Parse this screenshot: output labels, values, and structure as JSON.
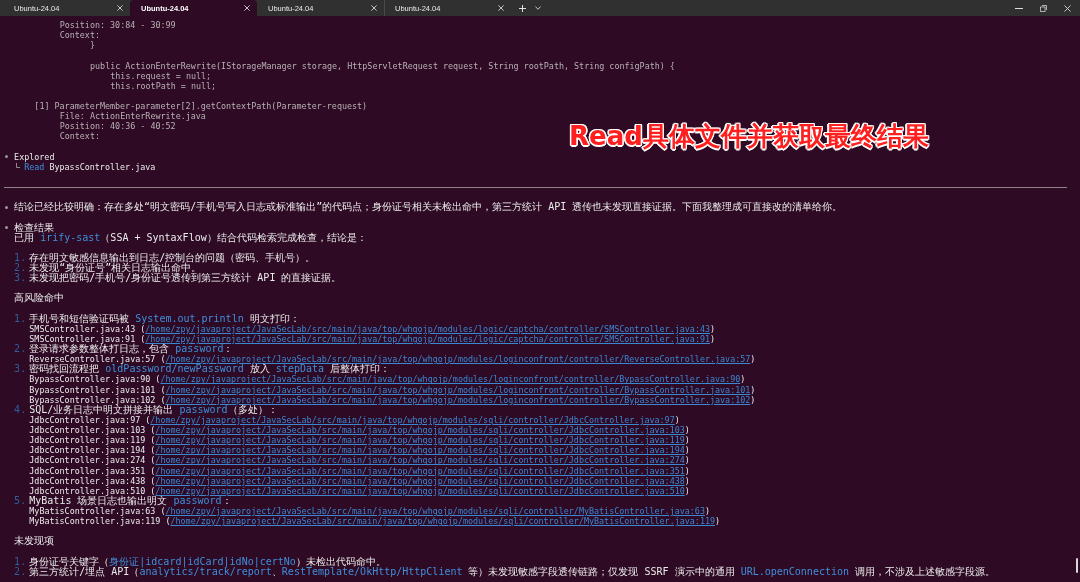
{
  "tabs": [
    {
      "label": "Ubuntu-24.04",
      "selected": false
    },
    {
      "label": "Ubuntu-24.04",
      "selected": true
    },
    {
      "label": "Ubuntu-24.04",
      "selected": false
    },
    {
      "label": "Ubuntu-24.04",
      "selected": false
    }
  ],
  "terminal": {
    "matches": [
      {
        "fields": [
          "Position: 30:84 - 30:99",
          "Context:"
        ],
        "context": [
          {
            "text": "}"
          },
          {
            "text": "public ActionEnterRewrite(IStorageManager storage, HttpServletRequest request, String rootPath, String configPath) {",
            "children": [
              {
                "text": "this.request = null;"
              },
              {
                "text": "this.rootPath = null;"
              }
            ]
          }
        ]
      },
      {
        "heading": "[1] ParameterMember-parameter[2].getContextPath(Parameter-request)",
        "fields": [
          "File: ActionEnterRewrite.java",
          "Position: 40:36 - 40:52",
          "Context:"
        ]
      }
    ],
    "explored": {
      "label": "Explored",
      "actions": [
        {
          "verb": "Read",
          "target": "BypassController.java"
        }
      ]
    },
    "summary": "结论已经比较明确：存在多处“明文密码/手机号写入日志或标准输出”的代码点；身份证号相关未检出命中，第三方统计 API 透传也未发现直接证据。下面我整理成可直接改的清单给你。",
    "report": {
      "heading": "检查结果",
      "intro": [
        {
          "text": "已用 ",
          "kind": "plain"
        },
        {
          "text": "irify-sast",
          "kind": "code"
        },
        {
          "text": "（SSA + SyntaxFlow）结合代码检索完成检查，结论是：",
          "kind": "plain"
        }
      ],
      "conclusions": [
        {
          "number": "1.",
          "text": "存在明文敏感信息输出到日志/控制台的问题（密码、手机号）。"
        },
        {
          "number": "2.",
          "text": "未发现“身份证号”相关日志输出命中。"
        },
        {
          "number": "3.",
          "text": "未发现把密码/手机号/身份证号透传到第三方统计 API 的直接证据。"
        }
      ],
      "sections": [
        {
          "title": "高风险命中",
          "items": [
            {
              "number": "1.",
              "parts": [
                {
                  "text": "手机号和短信验证码被 ",
                  "kind": "plain"
                },
                {
                  "text": "System.out.println",
                  "kind": "code"
                },
                {
                  "text": " 明文打印：",
                  "kind": "plain"
                }
              ],
              "refs": [
                {
                  "label": "SMSController.java:43 (",
                  "link": "/home/zpy/javaproject/JavaSecLab/src/main/java/top/whgojp/modules/logic/captcha/controller/SMSController.java:43",
                  "suffix": ")"
                },
                {
                  "label": "SMSController.java:91 (",
                  "link": "/home/zpy/javaproject/JavaSecLab/src/main/java/top/whgojp/modules/logic/captcha/controller/SMSController.java:91",
                  "suffix": ")"
                }
              ]
            },
            {
              "number": "2.",
              "parts": [
                {
                  "text": "登录请求参数整体打日志，包含 ",
                  "kind": "plain"
                },
                {
                  "text": "password",
                  "kind": "code"
                },
                {
                  "text": "：",
                  "kind": "plain"
                }
              ],
              "refs": [
                {
                  "label": "ReverseController.java:57 (",
                  "link": "/home/zpy/javaproject/JavaSecLab/src/main/java/top/whgojp/modules/loginconfront/controller/ReverseController.java:57",
                  "suffix": ")"
                }
              ]
            },
            {
              "number": "3.",
              "parts": [
                {
                  "text": "密码找回流程把 ",
                  "kind": "plain"
                },
                {
                  "text": "oldPassword/newPassword",
                  "kind": "code"
                },
                {
                  "text": " 放入 ",
                  "kind": "plain"
                },
                {
                  "text": "stepData",
                  "kind": "code"
                },
                {
                  "text": " 后整体打印：",
                  "kind": "plain"
                }
              ],
              "refs": [
                {
                  "label": "BypassController.java:90 (",
                  "link": "/home/zpy/javaproject/JavaSecLab/src/main/java/top/whgojp/modules/loginconfront/controller/BypassController.java:90",
                  "suffix": ")"
                },
                {
                  "label": "BypassController.java:101 (",
                  "link": "/home/zpy/javaproject/JavaSecLab/src/main/java/top/whgojp/modules/loginconfront/controller/BypassController.java:101",
                  "suffix": ")"
                },
                {
                  "label": "BypassController.java:102 (",
                  "link": "/home/zpy/javaproject/JavaSecLab/src/main/java/top/whgojp/modules/loginconfront/controller/BypassController.java:102",
                  "suffix": ")"
                }
              ]
            },
            {
              "number": "4.",
              "parts": [
                {
                  "text": "SQL/业务日志中明文拼接并输出 ",
                  "kind": "plain"
                },
                {
                  "text": "password",
                  "kind": "code"
                },
                {
                  "text": "（多处）：",
                  "kind": "plain"
                }
              ],
              "refs": [
                {
                  "label": "JdbcController.java:97 (",
                  "link": "/home/zpy/javaproject/JavaSecLab/src/main/java/top/whgojp/modules/sqli/controller/JdbcController.java:97",
                  "suffix": ")"
                },
                {
                  "label": "JdbcController.java:103 (",
                  "link": "/home/zpy/javaproject/JavaSecLab/src/main/java/top/whgojp/modules/sqli/controller/JdbcController.java:103",
                  "suffix": ")"
                },
                {
                  "label": "JdbcController.java:119 (",
                  "link": "/home/zpy/javaproject/JavaSecLab/src/main/java/top/whgojp/modules/sqli/controller/JdbcController.java:119",
                  "suffix": ")"
                },
                {
                  "label": "JdbcController.java:194 (",
                  "link": "/home/zpy/javaproject/JavaSecLab/src/main/java/top/whgojp/modules/sqli/controller/JdbcController.java:194",
                  "suffix": ")"
                },
                {
                  "label": "JdbcController.java:274 (",
                  "link": "/home/zpy/javaproject/JavaSecLab/src/main/java/top/whgojp/modules/sqli/controller/JdbcController.java:274",
                  "suffix": ")"
                },
                {
                  "label": "JdbcController.java:351 (",
                  "link": "/home/zpy/javaproject/JavaSecLab/src/main/java/top/whgojp/modules/sqli/controller/JdbcController.java:351",
                  "suffix": ")"
                },
                {
                  "label": "JdbcController.java:438 (",
                  "link": "/home/zpy/javaproject/JavaSecLab/src/main/java/top/whgojp/modules/sqli/controller/JdbcController.java:438",
                  "suffix": ")"
                },
                {
                  "label": "JdbcController.java:510 (",
                  "link": "/home/zpy/javaproject/JavaSecLab/src/main/java/top/whgojp/modules/sqli/controller/JdbcController.java:510",
                  "suffix": ")"
                }
              ]
            },
            {
              "number": "5.",
              "parts": [
                {
                  "text": "MyBatis 场景日志也输出明文 ",
                  "kind": "plain"
                },
                {
                  "text": "password",
                  "kind": "code"
                },
                {
                  "text": "：",
                  "kind": "plain"
                }
              ],
              "refs": [
                {
                  "label": "MyBatisController.java:63 (",
                  "link": "/home/zpy/javaproject/JavaSecLab/src/main/java/top/whgojp/modules/sqli/controller/MyBatisController.java:63",
                  "suffix": ")"
                },
                {
                  "label": "MyBatisController.java:119 (",
                  "link": "/home/zpy/javaproject/JavaSecLab/src/main/java/top/whgojp/modules/sqli/controller/MyBatisController.java:119",
                  "suffix": ")"
                }
              ]
            }
          ]
        },
        {
          "title": "未发现项",
          "items": [
            {
              "number": "1.",
              "parts": [
                {
                  "text": "身份证号关键字（",
                  "kind": "plain"
                },
                {
                  "text": "身份证|idcard|idCard|idNo|certNo",
                  "kind": "code"
                },
                {
                  "text": "）未检出代码命中。",
                  "kind": "plain"
                }
              ]
            },
            {
              "number": "2.",
              "parts": [
                {
                  "text": "第三方统计/埋点 API（",
                  "kind": "plain"
                },
                {
                  "text": "analytics/track/report",
                  "kind": "code"
                },
                {
                  "text": "、",
                  "kind": "plain"
                },
                {
                  "text": "RestTemplate/OkHttp/HttpClient",
                  "kind": "code"
                },
                {
                  "text": " 等）未发现敏感字段透传链路；仅发现 SSRF 演示中的通用 ",
                  "kind": "plain"
                },
                {
                  "text": "URL.openConnection",
                  "kind": "code"
                },
                {
                  "text": " 调用，不涉及上述敏感字段源。",
                  "kind": "plain"
                }
              ]
            }
          ]
        }
      ]
    }
  },
  "annotation": "Read具体文件并获取最终结果"
}
